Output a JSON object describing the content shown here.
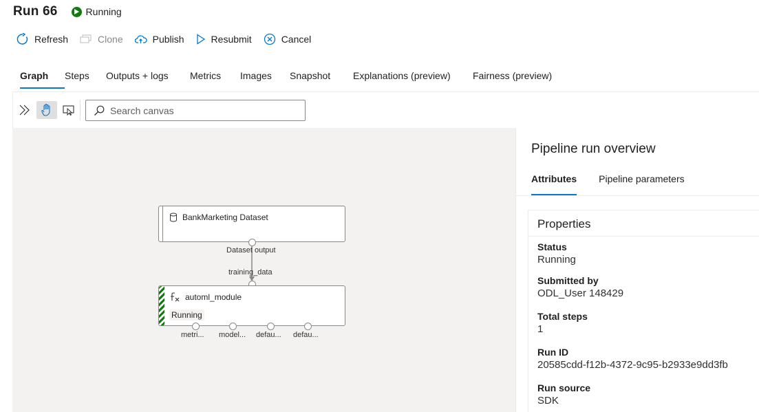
{
  "header": {
    "run_title": "Run 66",
    "status": "Running",
    "status_color": "#107c10"
  },
  "toolbar": {
    "refresh": "Refresh",
    "clone": "Clone",
    "publish": "Publish",
    "resubmit": "Resubmit",
    "cancel": "Cancel"
  },
  "tabs": [
    {
      "label": "Graph",
      "active": true
    },
    {
      "label": "Steps"
    },
    {
      "label": "Outputs + logs"
    },
    {
      "label": "Metrics"
    },
    {
      "label": "Images"
    },
    {
      "label": "Snapshot"
    },
    {
      "label": "Explanations (preview)"
    },
    {
      "label": "Fairness (preview)"
    }
  ],
  "canvas_toolbar": {
    "search_placeholder": "Search canvas"
  },
  "graph": {
    "dataset_node": {
      "title": "BankMarketing Dataset",
      "output_label": "Dataset output"
    },
    "edge_label": "training_data",
    "module_node": {
      "title": "automl_module",
      "status": "Running",
      "outputs": [
        "metri...",
        "model...",
        "defau...",
        "defau..."
      ]
    }
  },
  "panel": {
    "title": "Pipeline run overview",
    "tabs": [
      "Attributes",
      "Pipeline parameters"
    ],
    "properties_heading": "Properties",
    "properties": [
      {
        "label": "Status",
        "value": "Running"
      },
      {
        "label": "Submitted by",
        "value": "ODL_User 148429"
      },
      {
        "label": "Total steps",
        "value": "1"
      },
      {
        "label": "Run ID",
        "value": "20585cdd-f12b-4372-9c95-b2933e9dd3fb"
      },
      {
        "label": "Run source",
        "value": "SDK"
      }
    ]
  },
  "colors": {
    "accent": "#0078d4",
    "running_green": "#107c10"
  }
}
